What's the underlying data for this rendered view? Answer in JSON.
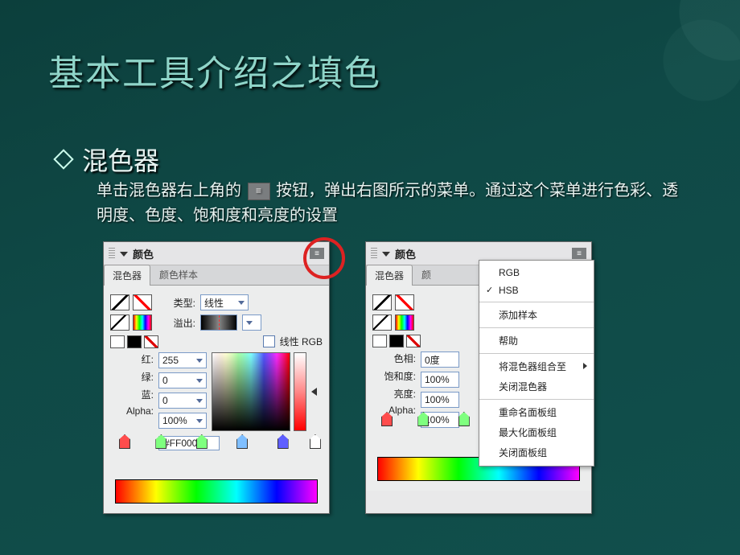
{
  "slide": {
    "title": "基本工具介绍之填色",
    "bullet": "混色器",
    "desc_before": "单击混色器右上角的",
    "desc_after": " 按钮，弹出右图所示的菜单。通过这个菜单进行色彩、透明度、色度、饱和度和亮度的设置"
  },
  "panel_left": {
    "header": "颜色",
    "tabs": [
      "混色器",
      "颜色样本"
    ],
    "type_label": "类型:",
    "type_value": "线性",
    "overflow_label": "溢出:",
    "linear_rgb": "线性 RGB",
    "fields": {
      "r_label": "红:",
      "r": "255",
      "g_label": "绿:",
      "g": "0",
      "b_label": "蓝:",
      "b": "0",
      "a_label": "Alpha:",
      "a": "100%",
      "hex": "#FF0000"
    }
  },
  "panel_right": {
    "header": "颜色",
    "tabs": [
      "混色器",
      "颜"
    ],
    "fields": {
      "hue_label": "色相:",
      "hue": "0度",
      "sat_label": "饱和度:",
      "sat": "100%",
      "lum_label": "亮度:",
      "lum": "100%",
      "a_label": "Alpha:",
      "a": "100%"
    },
    "menu": {
      "rgb": "RGB",
      "hsb": "HSB",
      "add_swatch": "添加样本",
      "help": "帮助",
      "group": "将混色器组合至",
      "close_mixer": "关闭混色器",
      "rename": "重命名面板组",
      "maximize": "最大化面板组",
      "close_group": "关闭面板组"
    }
  }
}
